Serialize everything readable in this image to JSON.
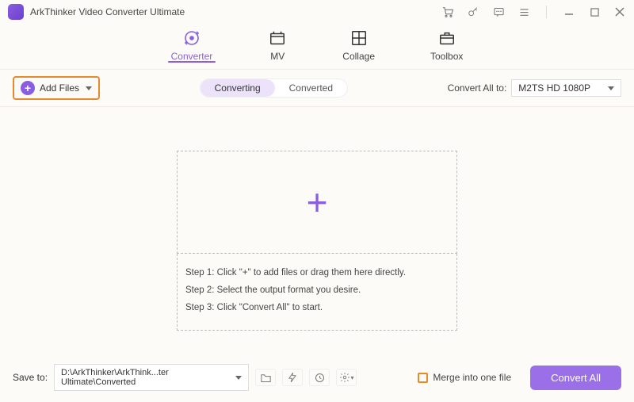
{
  "title": "ArkThinker Video Converter Ultimate",
  "tabs": {
    "converter": "Converter",
    "mv": "MV",
    "collage": "Collage",
    "toolbox": "Toolbox"
  },
  "addFilesLabel": "Add Files",
  "seg": {
    "converting": "Converting",
    "converted": "Converted"
  },
  "convertAllLabel": "Convert All to:",
  "formatSelected": "M2TS HD 1080P",
  "steps": {
    "s1": "Step 1: Click \"+\" to add files or drag them here directly.",
    "s2": "Step 2: Select the output format you desire.",
    "s3": "Step 3: Click \"Convert All\" to start."
  },
  "saveToLabel": "Save to:",
  "savePath": "D:\\ArkThinker\\ArkThink...ter Ultimate\\Converted",
  "mergeLabel": "Merge into one file",
  "convertAllBtn": "Convert All"
}
